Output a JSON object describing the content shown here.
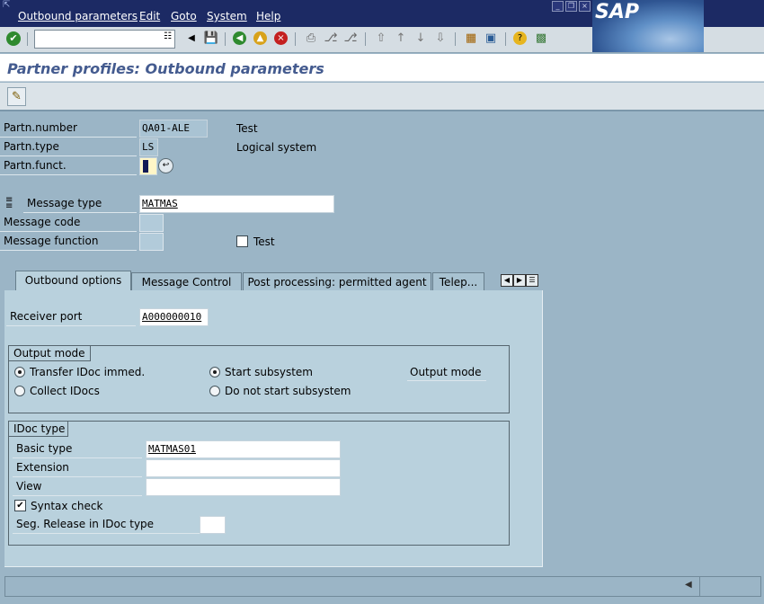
{
  "menu": {
    "items": [
      "Outbound parameters",
      "Edit",
      "Goto",
      "System",
      "Help"
    ]
  },
  "window_buttons": [
    "minimize-icon",
    "restore-icon",
    "close-icon"
  ],
  "brand": "SAP",
  "toolbar": {
    "command_field_value": "",
    "icons": [
      "enter-icon",
      "save-icon",
      "back-icon",
      "exit-icon",
      "cancel-icon",
      "print-icon",
      "find-icon",
      "find-next-icon",
      "first-page-icon",
      "previous-page-icon",
      "next-page-icon",
      "last-page-icon",
      "create-session-icon",
      "shortcut-icon",
      "help-icon",
      "layout-menu-icon"
    ]
  },
  "title": "Partner profiles: Outbound parameters",
  "app_toolbar": {
    "icons": [
      "edit-pencil-icon"
    ]
  },
  "header": {
    "partner_number": {
      "label": "Partn.number",
      "value": "QA01-ALE",
      "description": "Test"
    },
    "partner_type": {
      "label": "Partn.type",
      "value": "LS",
      "description": "Logical system"
    },
    "partner_function": {
      "label": "Partn.funct.",
      "value": ""
    },
    "message_type": {
      "label": "Message type",
      "value": "MATMAS"
    },
    "message_code": {
      "label": "Message code",
      "value": ""
    },
    "message_function": {
      "label": "Message function",
      "value": ""
    },
    "test": {
      "label": "Test",
      "checked": false
    }
  },
  "tabs": [
    "Outbound options",
    "Message Control",
    "Post processing: permitted agent",
    "Telep..."
  ],
  "active_tab": "Outbound options",
  "outbound_options": {
    "receiver_port": {
      "label": "Receiver port",
      "value": "A000000010"
    },
    "output_mode": {
      "title": "Output mode",
      "transfer_immediately": {
        "label": "Transfer IDoc immed.",
        "selected": true
      },
      "collect_idocs": {
        "label": "Collect IDocs",
        "selected": false
      },
      "start_subsystem": {
        "label": "Start subsystem",
        "selected": true
      },
      "do_not_start": {
        "label": "Do not start subsystem",
        "selected": false
      },
      "output_mode_field_label": "Output mode"
    },
    "idoc_type": {
      "title": "IDoc type",
      "basic_type": {
        "label": "Basic type",
        "value": "MATMAS01"
      },
      "extension": {
        "label": "Extension",
        "value": ""
      },
      "view": {
        "label": "View",
        "value": ""
      },
      "syntax_check": {
        "label": "Syntax check",
        "checked": true
      },
      "seg_release": {
        "label": "Seg. Release in IDoc type",
        "value": ""
      }
    }
  }
}
